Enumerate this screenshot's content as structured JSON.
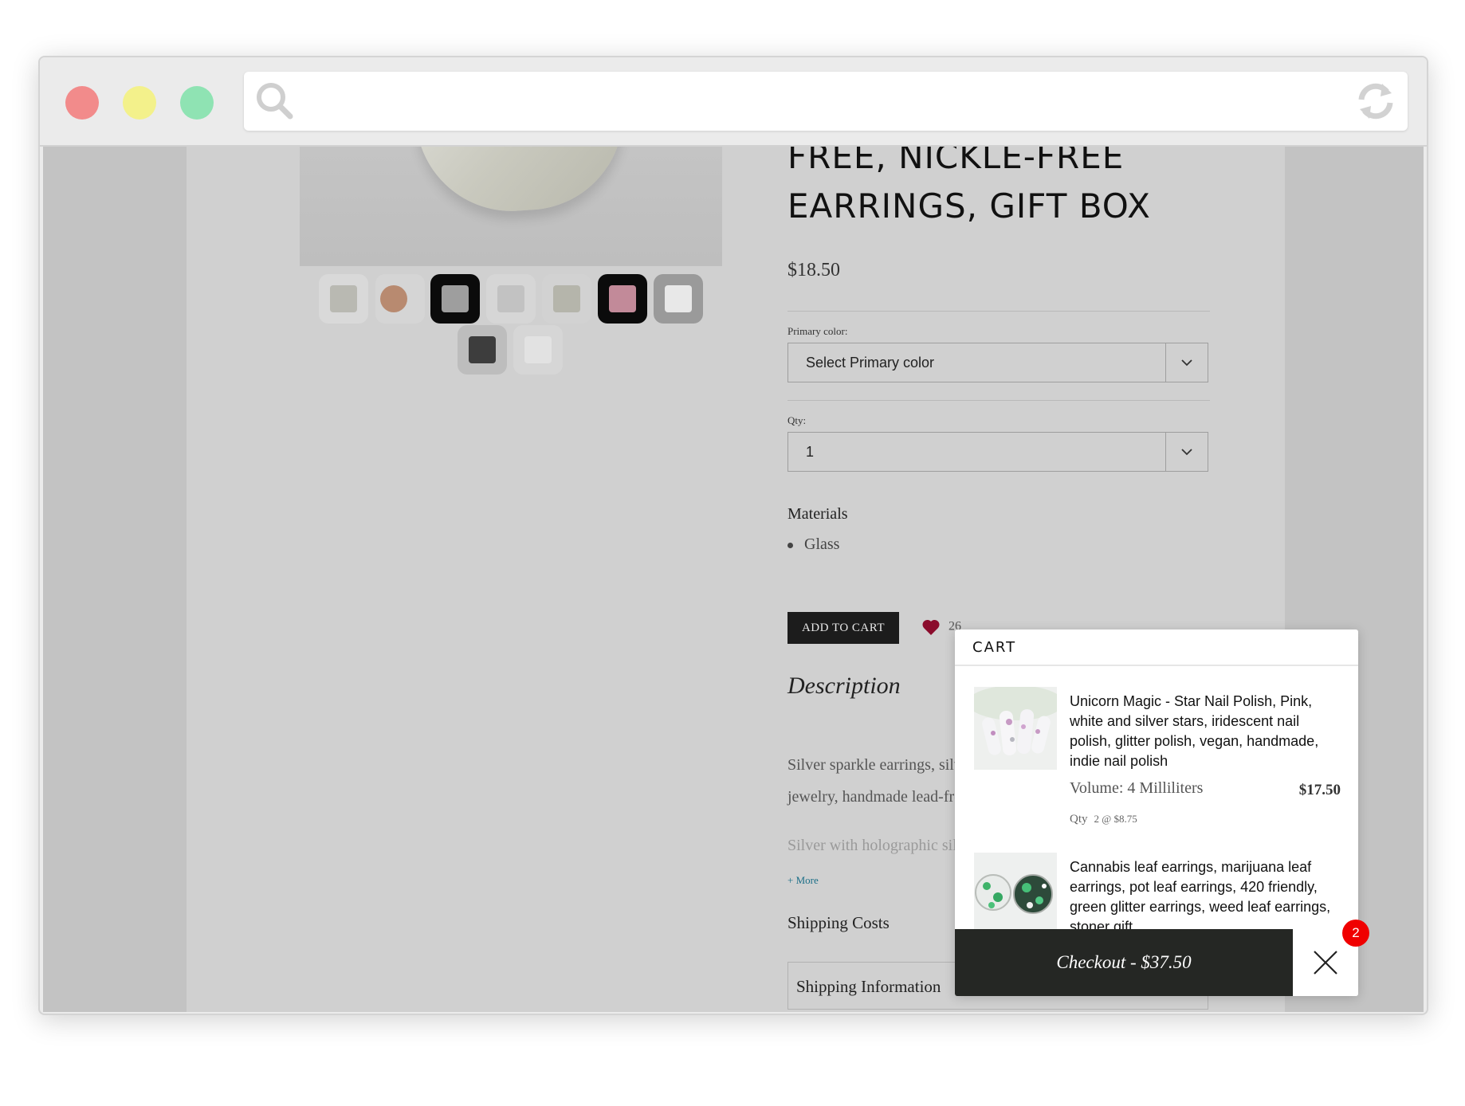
{
  "product": {
    "title_line1": "FREE, NICKLE-FREE",
    "title_line2": "EARRINGS, GIFT BOX",
    "price": "$18.50",
    "primary_color_label": "Primary color:",
    "primary_color_value": "Select Primary color",
    "qty_label": "Qty:",
    "qty_value": "1",
    "materials_heading": "Materials",
    "materials": [
      "Glass"
    ],
    "add_to_cart_label": "ADD TO CART",
    "favorites_count": "26",
    "description_heading": "Description",
    "description_line1": "Silver sparkle earrings, silver he",
    "description_line2": "jewelry, handmade lead-free, ni",
    "description_line3": "Silver with holographic silver g",
    "more_label": "+ More",
    "shipping_heading": "Shipping Costs",
    "shipping_info_label": "Shipping Information"
  },
  "cart": {
    "heading": "CART",
    "items": [
      {
        "name": "Unicorn Magic - Star Nail Polish, Pink, white and silver stars, iridescent nail polish, glitter polish, vegan, handmade, indie nail polish",
        "variant": "Volume: 4 Milliliters",
        "price": "$17.50",
        "qty_label": "Qty",
        "qty_value": "2 @ $8.75"
      },
      {
        "name": "Cannabis leaf earrings, marijuana leaf earrings, pot leaf earrings, 420 friendly, green glitter earrings, weed leaf earrings, stoner gift"
      }
    ],
    "checkout_label": "Checkout - $37.50",
    "badge_count": "2"
  },
  "icons": {
    "search": "search-icon",
    "refresh": "refresh-icon",
    "chevron": "chevron-down-icon",
    "heart": "heart-icon",
    "close": "close-icon"
  },
  "colors": {
    "heart": "#8b0c2c",
    "badge": "#f00000",
    "checkout": "#252724",
    "more_link": "#1c6f88"
  }
}
